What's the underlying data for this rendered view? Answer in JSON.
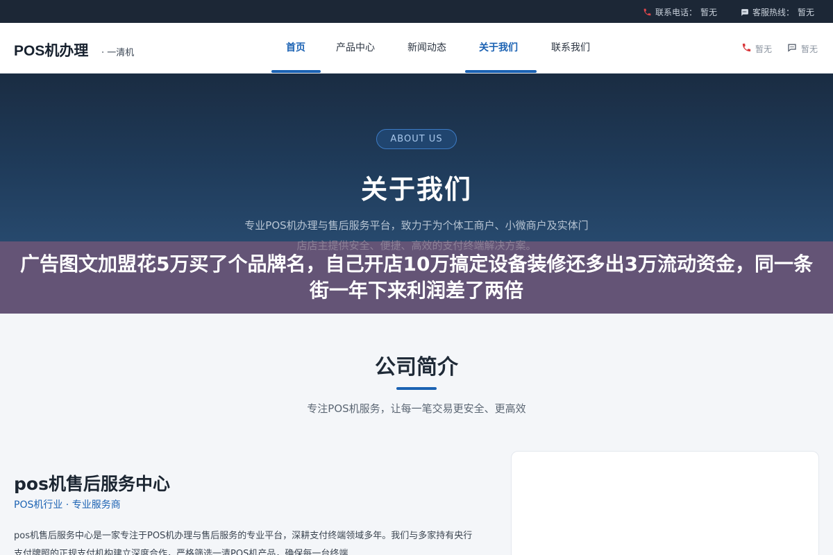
{
  "topbar": {
    "phone_label": "联系电话：",
    "phone_value": "暂无",
    "service_label": "客服热线：",
    "service_value": "暂无"
  },
  "header": {
    "logo": "POS机办理",
    "logo_sub": "· 一清机",
    "nav": [
      {
        "label": "首页",
        "active": true
      },
      {
        "label": "产品中心",
        "active": false
      },
      {
        "label": "新闻动态",
        "active": false
      },
      {
        "label": "关于我们",
        "active": true
      },
      {
        "label": "联系我们",
        "active": false
      }
    ],
    "phone_value": "暂无",
    "chat_value": "暂无"
  },
  "hero": {
    "badge": "ABOUT US",
    "title": "关于我们",
    "desc_line1": "专业POS机办理与售后服务平台，致力于为个体工商户、小微商户及实体门",
    "desc_line2": "店店主提供安全、便捷、高效的支付终端解决方案。"
  },
  "banner": {
    "text": "广告图文加盟花5万买了个品牌名，自己开店10万搞定设备装修还多出3万流动资金，同一条街一年下来利润差了两倍"
  },
  "section": {
    "title": "公司简介",
    "subtitle": "专注POS机服务，让每一笔交易更安全、更高效"
  },
  "company": {
    "name": "pos机售后服务中心",
    "tagline": "POS机行业 · 专业服务商",
    "desc": "pos机售后服务中心是一家专注于POS机办理与售后服务的专业平台，深耕支付终端领域多年。我们与多家持有央行支付牌照的正规支付机构建立深度合作，严格筛选一清POS机产品，确保每一台终端"
  },
  "colors": {
    "accent": "#1b62b3",
    "topbar_bg": "#1c2736",
    "hero_bg": "#1f3b5a",
    "banner_bg": "#645476",
    "phone_icon": "#d9373b"
  },
  "icons": {
    "phone": "phone-icon",
    "chat": "chat-icon"
  }
}
